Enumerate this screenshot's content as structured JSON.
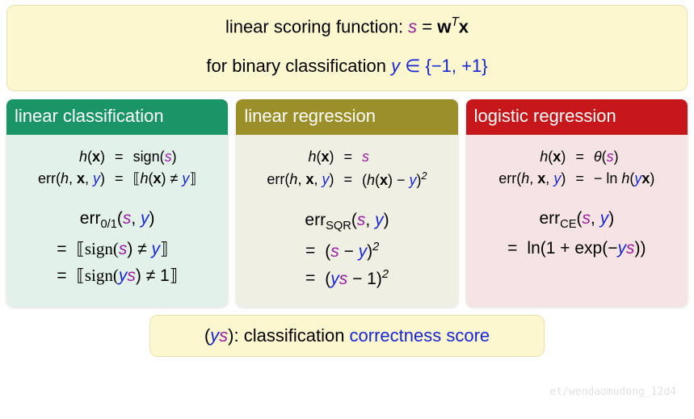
{
  "intro": {
    "line1_pre": "linear scoring function: ",
    "line1_s": "s",
    "line1_eq": " = ",
    "line1_w": "w",
    "line1_T": "T",
    "line1_x": "x",
    "line2_pre": "for binary classification ",
    "line2_y": "y",
    "line2_in": " ∈ ",
    "line2_set": "{−1, +1}"
  },
  "cols": {
    "c1": {
      "title": "linear classification",
      "r1_lhs_h": "h",
      "r1_lhs_x": "x",
      "r1_rhs": "sign(",
      "r1_s": "s",
      "r1_rhs2": ")",
      "r2_lhs_err": "err(",
      "r2_lhs_h": "h",
      "r2_lhs_x": "x",
      "r2_lhs_y": "y",
      "r2_rhs_open": "⟦",
      "r2_rhs_h": "h",
      "r2_rhs_x": "x",
      "r2_rhs_neq": " ≠ ",
      "r2_rhs_y": "y",
      "r2_rhs_close": "⟧",
      "err_title_pre": "err",
      "err_title_sub": "0/1",
      "err_title_args_s": "s",
      "err_title_args_y": "y",
      "e1": "⟦sign(",
      "e1_s": "s",
      "e1_mid": ") ≠ ",
      "e1_y": "y",
      "e1_close": "⟧",
      "e2": "⟦sign(",
      "e2_y": "y",
      "e2_s": "s",
      "e2_mid": ") ≠ 1⟧"
    },
    "c2": {
      "title": "linear regression",
      "r1_lhs_h": "h",
      "r1_lhs_x": "x",
      "r1_rhs_s": "s",
      "r2_lhs_err": "err(",
      "r2_lhs_h": "h",
      "r2_lhs_x": "x",
      "r2_lhs_y": "y",
      "r2_rhs_open": "(",
      "r2_rhs_h": "h",
      "r2_rhs_x": "x",
      "r2_rhs_mid": ") − ",
      "r2_rhs_y": "y",
      "r2_rhs_close": ")",
      "r2_rhs_sq": "2",
      "err_title_pre": "err",
      "err_title_sub": "SQR",
      "err_title_args_s": "s",
      "err_title_args_y": "y",
      "e1_open": "(",
      "e1_s": "s",
      "e1_mid": " − ",
      "e1_y": "y",
      "e1_close": ")",
      "e1_sq": "2",
      "e2_open": "(",
      "e2_y": "y",
      "e2_s": "s",
      "e2_mid": " − 1)",
      "e2_sq": "2"
    },
    "c3": {
      "title": "logistic regression",
      "r1_lhs_h": "h",
      "r1_lhs_x": "x",
      "r1_rhs_theta": "θ",
      "r1_rhs_open": "(",
      "r1_rhs_s": "s",
      "r1_rhs_close": ")",
      "r2_lhs_err": "err(",
      "r2_lhs_h": "h",
      "r2_lhs_x": "x",
      "r2_lhs_y": "y",
      "r2_rhs_pre": "− ln ",
      "r2_rhs_h": "h",
      "r2_rhs_open": "(",
      "r2_rhs_y": "y",
      "r2_rhs_x2": "x",
      "r2_rhs_close": ")",
      "err_title_pre": "err",
      "err_title_sub": "CE",
      "err_title_args_s": "s",
      "err_title_args_y": "y",
      "e1_pre": "ln(1 + exp(−",
      "e1_y": "y",
      "e1_s": "s",
      "e1_post": "))"
    }
  },
  "bottom": {
    "open": "(",
    "y": "y",
    "s": "s",
    "close": "): classification ",
    "cs": "correctness score"
  },
  "watermark": "et/wendaomudong_12d4",
  "symbols": {
    "eq": "="
  }
}
